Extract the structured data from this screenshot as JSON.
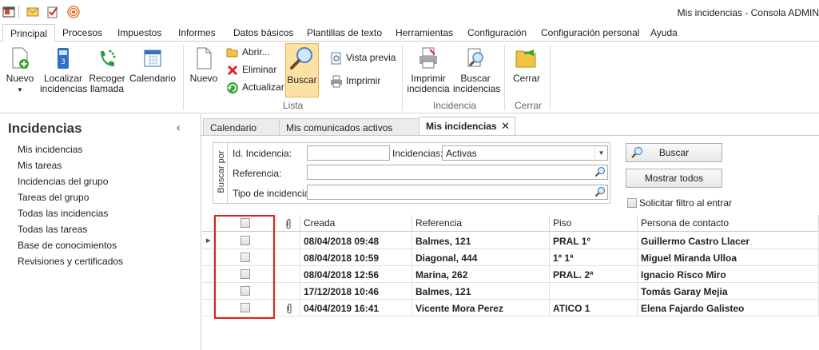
{
  "window": {
    "title": "Mis incidencias - Consola ADMIN"
  },
  "menu": {
    "tabs": [
      "Principal",
      "Procesos",
      "Impuestos",
      "Informes",
      "Datos básicos",
      "Plantillas de texto",
      "Herramientas",
      "Configuración",
      "Configuración personal",
      "Ayuda"
    ]
  },
  "ribbon": {
    "nuevo": "Nuevo",
    "localizar_1": "Localizar",
    "localizar_2": "incidencias",
    "recoger_1": "Recoger",
    "recoger_2": "llamada",
    "calendario": "Calendario",
    "nuevo2": "Nuevo",
    "abrir": "Abrir...",
    "eliminar": "Eliminar",
    "actualizar": "Actualizar",
    "buscar": "Buscar",
    "vista_previa": "Vista previa",
    "imprimir": "Imprimir",
    "group_lista": "Lista",
    "imprimir_inc_1": "Imprimir",
    "imprimir_inc_2": "incidencia",
    "buscar_inc_1": "Buscar",
    "buscar_inc_2": "incidencias",
    "group_incidencia": "Incidencia",
    "cerrar": "Cerrar",
    "group_cerrar": "Cerrar"
  },
  "left": {
    "title": "Incidencias",
    "collapse": "‹",
    "items": [
      "Mis incidencias",
      "Mis tareas",
      "Incidencias del grupo",
      "Tareas del grupo",
      "Todas las incidencias",
      "Todas las tareas",
      "Base de conocimientos",
      "Revisiones y certificados"
    ]
  },
  "doctabs": {
    "tab1": "Calendario",
    "tab2": "Mis comunicados activos",
    "tab3": "Mis incidencias",
    "close": "✕"
  },
  "search": {
    "group_label": "Buscar por",
    "id_label": "Id. Incidencia:",
    "id_value": "",
    "incid_label": "Incidencias:",
    "incid_value": "Activas",
    "ref_label": "Referencia:",
    "ref_value": "",
    "tipo_label": "Tipo de incidencia:",
    "tipo_value": "",
    "buscar_btn": "Buscar",
    "mostrar_btn": "Mostrar todos",
    "solicitar": "Solicitar filtro al entrar"
  },
  "grid": {
    "headers": {
      "creada": "Creada",
      "referencia": "Referencia",
      "piso": "Piso",
      "persona": "Persona de contacto"
    },
    "rows": [
      {
        "creada": "08/04/2018 09:48",
        "referencia": "Balmes, 121",
        "piso": "PRAL 1º",
        "persona": "Guillermo Castro Llacer",
        "attach": false,
        "current": true
      },
      {
        "creada": "08/04/2018 10:59",
        "referencia": "Diagonal, 444",
        "piso": "1º 1ª",
        "persona": "Miguel Miranda Ulloa",
        "attach": false,
        "current": false
      },
      {
        "creada": "08/04/2018 12:56",
        "referencia": "Marina, 262",
        "piso": "PRAL. 2ª",
        "persona": "Ignacio Risco Miro",
        "attach": false,
        "current": false
      },
      {
        "creada": "17/12/2018 10:46",
        "referencia": "Balmes, 121",
        "piso": "",
        "persona": "Tomás Garay Mejia",
        "attach": false,
        "current": false
      },
      {
        "creada": "04/04/2019 16:41",
        "referencia": "Vicente Mora Perez",
        "piso": "ATICO 1",
        "persona": "Elena Fajardo Galisteo",
        "attach": true,
        "current": false
      }
    ]
  }
}
